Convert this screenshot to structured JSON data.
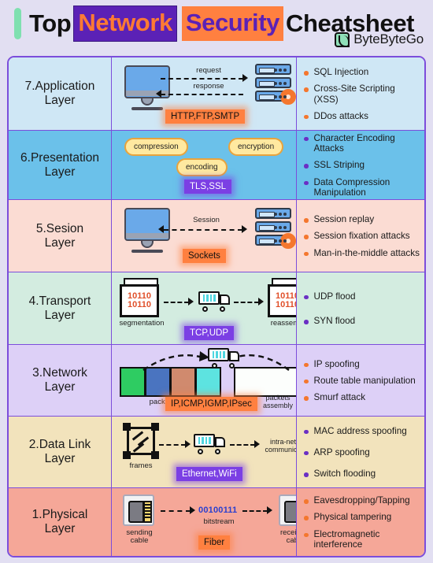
{
  "header": {
    "word1": "Top",
    "word2": "Network",
    "word3": "Security",
    "word4": "Cheatsheet",
    "brand": "ByteByteGo",
    "colors": {
      "network_bg": "#5b21b6",
      "network_fg": "#ff7a33",
      "security_bg": "#ff8040",
      "security_fg": "#5b21b6",
      "accent_bar": "#7fe0b0",
      "logo_green": "#8fe0b8"
    }
  },
  "palette": {
    "frame_border": "#7c4ddb",
    "bullet_orange": "#f4772e",
    "bullet_purple": "#6b2fc4",
    "chip_orange": "#ff8040",
    "chip_purple": "#7b3fe4"
  },
  "layers": [
    {
      "id": "application",
      "label": "7.Application\nLayer",
      "label_line1": "7.Application",
      "label_line2": "Layer",
      "bg": "#cfe7f5",
      "bullet": "orange",
      "protocol_chip": "HTTP,FTP,SMTP",
      "chip_style": "orange",
      "diagram_labels": [
        "request",
        "response"
      ],
      "attacks": [
        "SQL Injection",
        "Cross-Site Scripting (XSS)",
        "DDos attacks"
      ]
    },
    {
      "id": "presentation",
      "label_line1": "6.Presentation",
      "label_line2": "Layer",
      "bg": "#6bc1ea",
      "bullet": "purple",
      "protocol_chip": "TLS,SSL",
      "chip_style": "purple",
      "pills": [
        "compression",
        "encryption",
        "encoding"
      ],
      "attacks": [
        "Character Encoding Attacks",
        "SSL Striping",
        "Data Compression Manipulation"
      ]
    },
    {
      "id": "session",
      "label_line1": "5.Sesion",
      "label_line2": "Layer",
      "bg": "#fbdcd3",
      "bullet": "orange",
      "protocol_chip": "Sockets",
      "chip_style": "orange",
      "diagram_labels": [
        "Session"
      ],
      "attacks": [
        "Session replay",
        "Session fixation attacks",
        "Man-in-the-middle attacks"
      ]
    },
    {
      "id": "transport",
      "label_line1": "4.Transport",
      "label_line2": "Layer",
      "bg": "#d3ece0",
      "bullet": "purple",
      "protocol_chip": "TCP,UDP",
      "chip_style": "purple",
      "diagram_labels": [
        "segmentation",
        "reassembly"
      ],
      "binary": "10110",
      "binary2": "10110",
      "attacks": [
        "UDP flood",
        "SYN flood"
      ]
    },
    {
      "id": "network",
      "label_line1": "3.Network",
      "label_line2": "Layer",
      "bg": "#ddd0f7",
      "bullet": "orange",
      "protocol_chip": "IP,ICMP,IGMP,IPsec",
      "chip_style": "orange",
      "diagram_labels": [
        "packets",
        "packets assembly"
      ],
      "packet_colors": [
        "#2ecc62",
        "#4a74c0",
        "#d08a6e",
        "#5de3e0"
      ],
      "attacks": [
        "IP spoofing",
        "Route table manipulation",
        "Smurf attack"
      ]
    },
    {
      "id": "datalink",
      "label_line1": "2.Data Link",
      "label_line2": "Layer",
      "bg": "#f2e3bc",
      "bullet": "purple",
      "protocol_chip": "Ethernet,WiFi",
      "chip_style": "purple",
      "diagram_labels": [
        "frames",
        "intra-network communications"
      ],
      "attacks": [
        "MAC address spoofing",
        "ARP spoofing",
        "Switch flooding"
      ]
    },
    {
      "id": "physical",
      "label_line1": "1.Physical",
      "label_line2": "Layer",
      "bg": "#f5a798",
      "bullet": "orange",
      "protocol_chip": "Fiber",
      "chip_style": "orange",
      "diagram_labels": [
        "sending cable",
        "receiving cable",
        "bitstream"
      ],
      "bitstream": "00100111",
      "attacks": [
        "Eavesdropping/Tapping",
        "Physical tampering",
        "Electromagnetic interference"
      ]
    }
  ]
}
